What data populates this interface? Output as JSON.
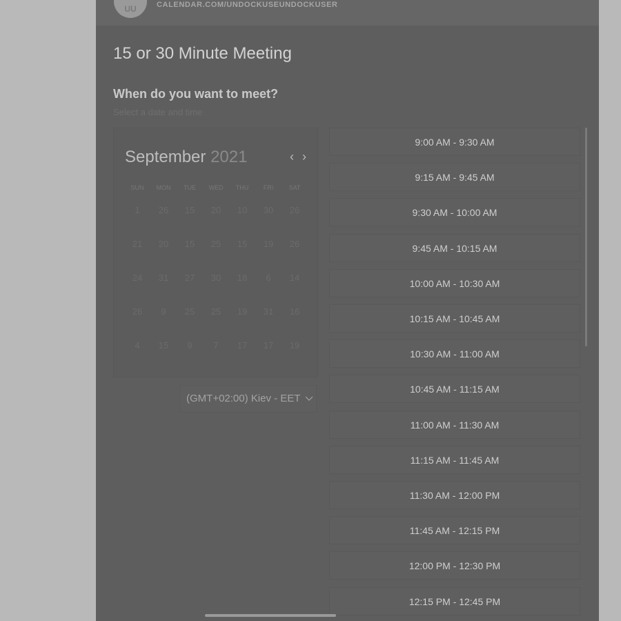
{
  "header": {
    "avatar_initials": "UU",
    "url": "CALENDAR.COM/UNDOCKUSEUNDOCKUSER"
  },
  "meeting": {
    "title": "15 or 30 Minute Meeting",
    "question": "When do you want to meet?",
    "subprompt": "Select a date and time"
  },
  "calendar": {
    "month": "September",
    "year": "2021",
    "prev_icon": "chevron-left-icon",
    "next_icon": "chevron-right-icon",
    "weekdays": [
      "SUN",
      "MON",
      "TUE",
      "WED",
      "THU",
      "FRI",
      "SAT"
    ],
    "weeks": [
      [
        "1",
        "26",
        "15",
        "20",
        "10",
        "30",
        "26"
      ],
      [
        "21",
        "20",
        "15",
        "25",
        "15",
        "19",
        "26"
      ],
      [
        "24",
        "31",
        "27",
        "30",
        "18",
        "6",
        "14"
      ],
      [
        "26",
        "9",
        "25",
        "25",
        "19",
        "31",
        "16"
      ],
      [
        "4",
        "15",
        "9",
        "7",
        "17",
        "17",
        "19"
      ]
    ]
  },
  "timezone": {
    "label": "(GMT+02:00) Kiev - EET",
    "icon": "chevron-down-icon"
  },
  "time_slots": [
    "9:00 AM - 9:30 AM",
    "9:15 AM - 9:45 AM",
    "9:30 AM - 10:00 AM",
    "9:45 AM - 10:15 AM",
    "10:00 AM - 10:30 AM",
    "10:15 AM - 10:45 AM",
    "10:30 AM - 11:00 AM",
    "10:45 AM - 11:15 AM",
    "11:00 AM - 11:30 AM",
    "11:15 AM - 11:45 AM",
    "11:30 AM - 12:00 PM",
    "11:45 AM - 12:15 PM",
    "12:00 PM - 12:30 PM",
    "12:15 PM - 12:45 PM"
  ],
  "colors": {
    "overlay_panel": "#5e5e5e",
    "page_background": "#b9b9b9"
  }
}
